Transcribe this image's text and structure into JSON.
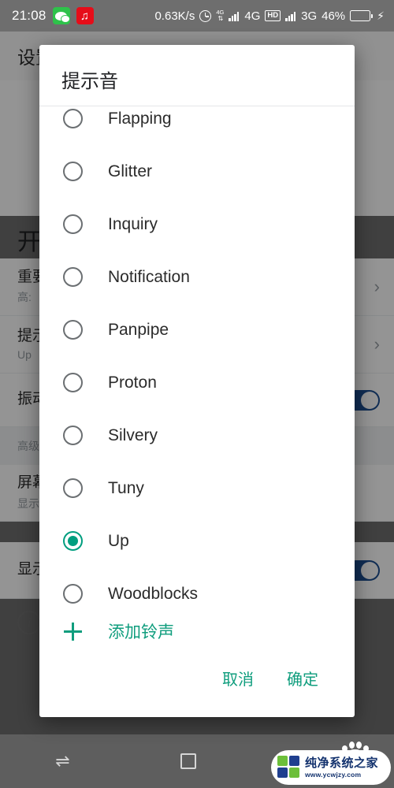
{
  "status_bar": {
    "clock": "21:08",
    "app_icons": [
      {
        "name": "wechat-icon",
        "label": ""
      },
      {
        "name": "netease-music-icon",
        "label": ""
      }
    ],
    "net_speed": "0.63K/s",
    "alarm_icon": "alarm-clock-icon",
    "data_transfer_label": "4G",
    "sim1_network": "4G",
    "hd_badge": "HD",
    "sim2_network": "3G",
    "battery_percent": "46%",
    "charging": true
  },
  "background_page": {
    "toolbar_title": "设置",
    "app_title": "开",
    "rows": [
      {
        "title": "重要",
        "subtitle": "高:",
        "control": "chevron"
      },
      {
        "title": "提示",
        "subtitle": "Up",
        "control": "chevron"
      },
      {
        "title": "振动",
        "subtitle": "",
        "control": "toggle"
      },
      {
        "title": "屏幕",
        "subtitle": "显示",
        "control": "none"
      },
      {
        "title": "显示",
        "subtitle": "",
        "control": "toggle"
      }
    ],
    "advanced_label": "高级",
    "info_icon": "info-icon"
  },
  "dialog": {
    "title": "提示音",
    "options": [
      {
        "label": "Flapping",
        "selected": false
      },
      {
        "label": "Glitter",
        "selected": false
      },
      {
        "label": "Inquiry",
        "selected": false
      },
      {
        "label": "Notification",
        "selected": false
      },
      {
        "label": "Panpipe",
        "selected": false
      },
      {
        "label": "Proton",
        "selected": false
      },
      {
        "label": "Silvery",
        "selected": false
      },
      {
        "label": "Tuny",
        "selected": false
      },
      {
        "label": "Up",
        "selected": true
      },
      {
        "label": "Woodblocks",
        "selected": false
      }
    ],
    "add_ringtone_label": "添加铃声",
    "add_icon": "plus-icon",
    "cancel_label": "取消",
    "confirm_label": "确定",
    "accent_color": "#0f9d7d",
    "selected_radio_color": "#009e7f"
  },
  "nav_bar": {
    "back_icon": "swap-arrows-icon",
    "home_icon": "square-recents-icon"
  },
  "watermark": {
    "brand_cn": "纯净系统之家",
    "url": "www.ycwjzy.com"
  }
}
